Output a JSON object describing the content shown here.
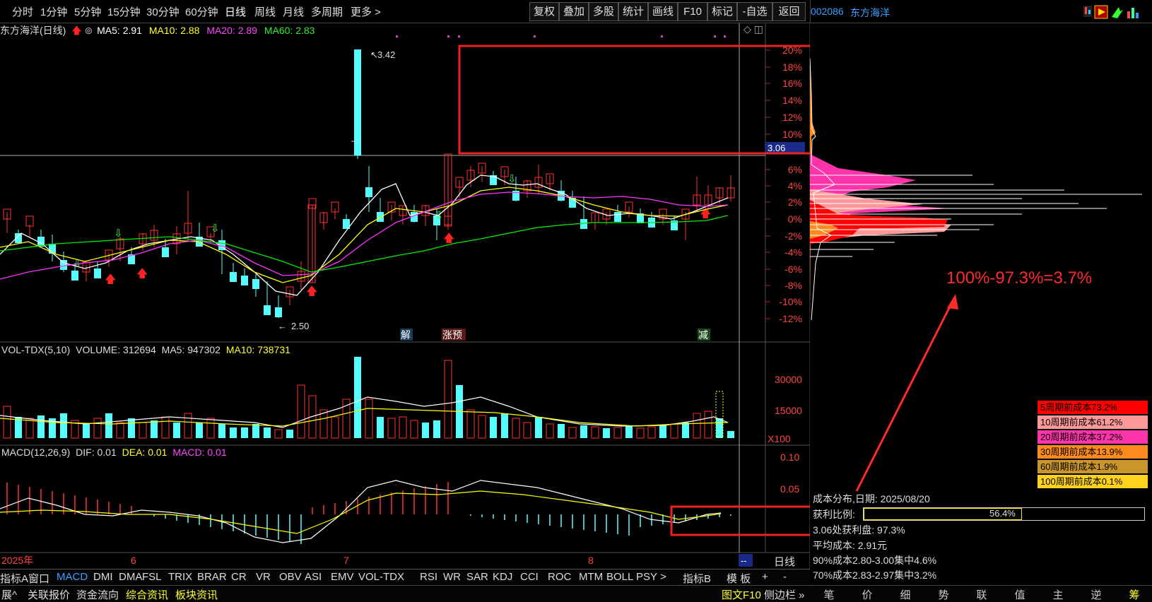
{
  "menubar": {
    "periods": [
      "分时",
      "1分钟",
      "5分钟",
      "15分钟",
      "30分钟",
      "60分钟",
      "日线",
      "周线",
      "月线",
      "多周期",
      "更多 >"
    ],
    "active_period": "日线",
    "tools": [
      "复权",
      "叠加",
      "多股",
      "统计",
      "画线",
      "F10",
      "标记",
      "-自选",
      "返回"
    ]
  },
  "stock": {
    "code": "002086",
    "name": "东方海洋"
  },
  "main_chart": {
    "title": "东方海洋(日线)",
    "ma5": "MA5: 2.91",
    "ma10": "MA10: 2.88",
    "ma20": "MA20: 2.89",
    "ma60": "MA60: 2.83",
    "high_label": "3.42",
    "low_label": "2.50",
    "price_tag": "3.06",
    "axis_pct": [
      "20%",
      "18%",
      "16%",
      "14%",
      "12%",
      "10%",
      "6%",
      "4%",
      "2%",
      "0%",
      "-2%",
      "-4%",
      "-6%",
      "-8%",
      "-10%",
      "-12%"
    ],
    "signals": {
      "jie": "解",
      "zhangyu": "涨预",
      "jian": "减"
    }
  },
  "volume_panel": {
    "title": "VOL-TDX(5,10)",
    "volume": "VOLUME: 312694",
    "ma5": "MA5: 947302",
    "ma10": "MA10: 738731",
    "axis": [
      "30000",
      "15000",
      "X100"
    ]
  },
  "macd_panel": {
    "title": "MACD(12,26,9)",
    "dif": "DIF: 0.01",
    "dea": "DEA: 0.01",
    "macd": "MACD: 0.01",
    "axis": [
      "0.10",
      "0.05"
    ]
  },
  "time_axis": [
    "2025年",
    "6",
    "7",
    "8",
    "--"
  ],
  "period_label": "日线",
  "indicator_tabs": [
    "指标A",
    "窗口",
    "MACD",
    "DMI",
    "DMA",
    "FSL",
    "TRIX",
    "BRAR",
    "CR",
    "VR",
    "OBV",
    "ASI",
    "EMV",
    "VOL-TDX",
    "RSI",
    "WR",
    "SAR",
    "KDJ",
    "CCI",
    "ROC",
    "MTM",
    "BOLL",
    "PSY",
    ">",
    "指标B",
    "模 板",
    "+",
    "-"
  ],
  "info_tabs": [
    "展^",
    "关联报价",
    "资金流向",
    "综合资讯",
    "板块资讯"
  ],
  "bottom_right": {
    "tuwen": "图文F10",
    "side": "侧边栏 »"
  },
  "right_nav": [
    "笔",
    "价",
    "细",
    "势",
    "联",
    "值",
    "主",
    "逆",
    "筹"
  ],
  "cost_dist": {
    "title": "成本分布,日期:  2025/08/20",
    "profit_ratio_label": "获利比例:",
    "profit_ratio": "56.4%",
    "profit_ratio_value": 0.564,
    "profit_at_price": "3.06处获利盘: 97.3%",
    "avg_cost": "平均成本: 2.91元",
    "c90": "90%成本2.80-3.00集中4.6%",
    "c70": "70%成本2.83-2.97集中3.2%"
  },
  "legend": [
    {
      "label": "5周期前成本73.2%",
      "color": "#ff0000"
    },
    {
      "label": "10周期前成本61.2%",
      "color": "#ff9999"
    },
    {
      "label": "20周期前成本37.2%",
      "color": "#ff33aa"
    },
    {
      "label": "30周期前成本13.9%",
      "color": "#ff8a1e"
    },
    {
      "label": "60周期前成本1.9%",
      "color": "#c8962a"
    },
    {
      "label": "100周期前成本0.1%",
      "color": "#ffd21e"
    }
  ],
  "annotation": "100%-97.3%=3.7%",
  "colors": {
    "up": "#ff3333",
    "down": "#54ffff",
    "ma5": "#ffffff",
    "ma10": "#ffff00",
    "ma20": "#ff33ff",
    "ma60": "#00ee00",
    "annotation": "#ff2a2a"
  }
}
